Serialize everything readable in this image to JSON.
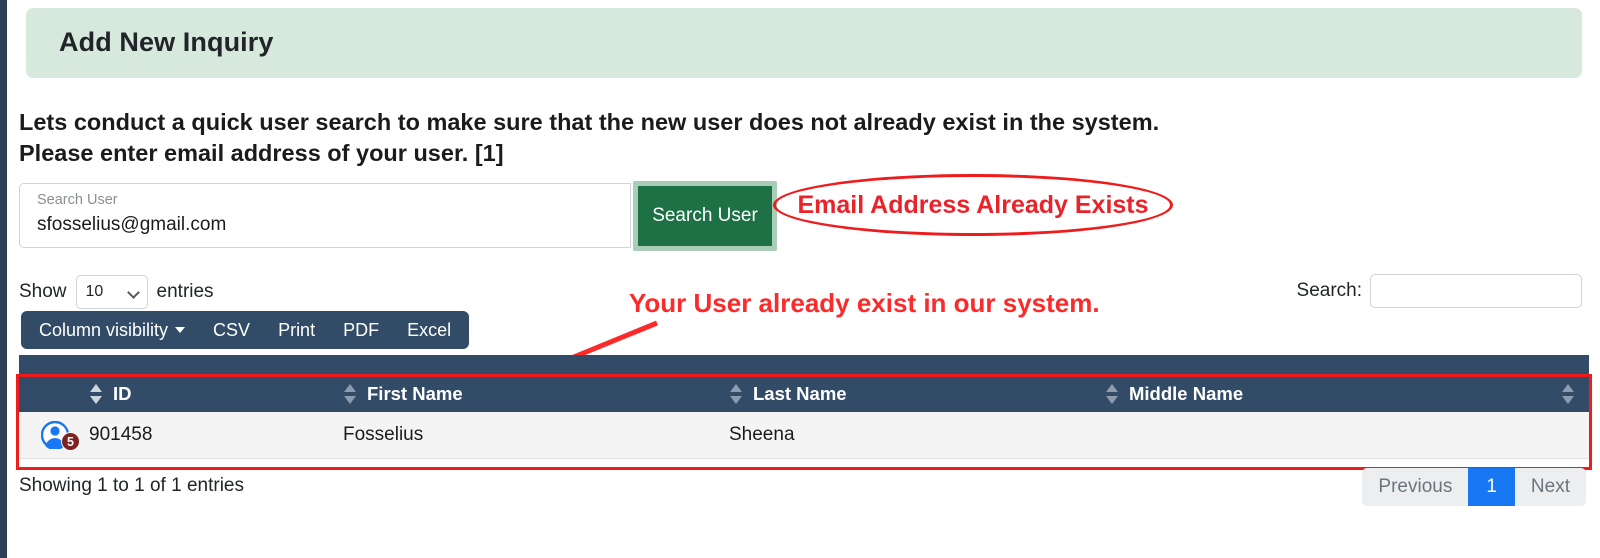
{
  "header": {
    "title": "Add New Inquiry"
  },
  "instructions": {
    "line1": "Lets conduct a quick user search to make sure that the new user does not already exist in the system.",
    "line2": "Please enter email address of your user. [1]"
  },
  "search_user": {
    "label": "Search User",
    "value": "sfosselius@gmail.com",
    "button_label": "Search User"
  },
  "annotations": {
    "ellipse_text": "Email Address Already Exists",
    "arrow_text": "Your User already exist in our system.",
    "accent_color": "#ee1c1c"
  },
  "datatable": {
    "show_label": "Show",
    "entries_label": "entries",
    "page_length": "10",
    "search_label": "Search:",
    "search_value": "",
    "export_buttons": [
      {
        "label": "Column visibility",
        "has_caret": true
      },
      {
        "label": "CSV",
        "has_caret": false
      },
      {
        "label": "Print",
        "has_caret": false
      },
      {
        "label": "PDF",
        "has_caret": false
      },
      {
        "label": "Excel",
        "has_caret": false
      }
    ],
    "columns": [
      "ID",
      "First Name",
      "Last Name",
      "Middle Name"
    ],
    "rows": [
      {
        "icon": "user-avatar-icon",
        "badge": "5",
        "id": "901458",
        "first_name": "Fosselius",
        "last_name": "Sheena",
        "middle_name": ""
      }
    ],
    "showing_info": "Showing 1 to 1 of 1 entries",
    "pagination": {
      "previous": "Previous",
      "page_1": "1",
      "next": "Next"
    }
  },
  "colors": {
    "banner": "#d7e8dc",
    "table_header": "#324b66",
    "primary_green": "#1e7145",
    "active_page": "#1878f3",
    "badge": "#7c2221"
  }
}
